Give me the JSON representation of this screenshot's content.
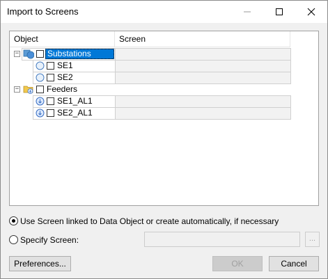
{
  "window": {
    "title": "Import to Screens",
    "controls": [
      "minimize-icon",
      "maximize-icon",
      "close-icon"
    ]
  },
  "tree": {
    "columns": [
      "Object",
      "Screen"
    ],
    "rows": [
      {
        "label": "Substations",
        "level": 0,
        "expander": "−",
        "icon": "substation-group-icon",
        "checked": false,
        "selected": true,
        "screen": ""
      },
      {
        "label": "SE1",
        "level": 1,
        "icon": "substation-node-icon",
        "checked": false,
        "selected": false,
        "screen": ""
      },
      {
        "label": "SE2",
        "level": 1,
        "icon": "substation-node-icon",
        "checked": false,
        "selected": false,
        "screen": ""
      },
      {
        "label": "Feeders",
        "level": 0,
        "expander": "−",
        "icon": "feeder-folder-icon",
        "checked": false,
        "selected": false,
        "screen": ""
      },
      {
        "label": "SE1_AL1",
        "level": 1,
        "icon": "feeder-node-icon",
        "checked": false,
        "selected": false,
        "screen": ""
      },
      {
        "label": "SE2_AL1",
        "level": 1,
        "icon": "feeder-node-icon",
        "checked": false,
        "selected": false,
        "screen": ""
      }
    ]
  },
  "options": {
    "auto_label": "Use Screen linked to Data Object or create automatically, if necessary",
    "auto_selected": true,
    "specify_label": "Specify Screen:",
    "specify_selected": false,
    "screen_value": "",
    "browse_label": "..."
  },
  "buttons": {
    "preferences": "Preferences...",
    "ok": "OK",
    "cancel": "Cancel"
  },
  "colors": {
    "selection": "#0078d7",
    "window_bg": "#f0f0f0"
  }
}
